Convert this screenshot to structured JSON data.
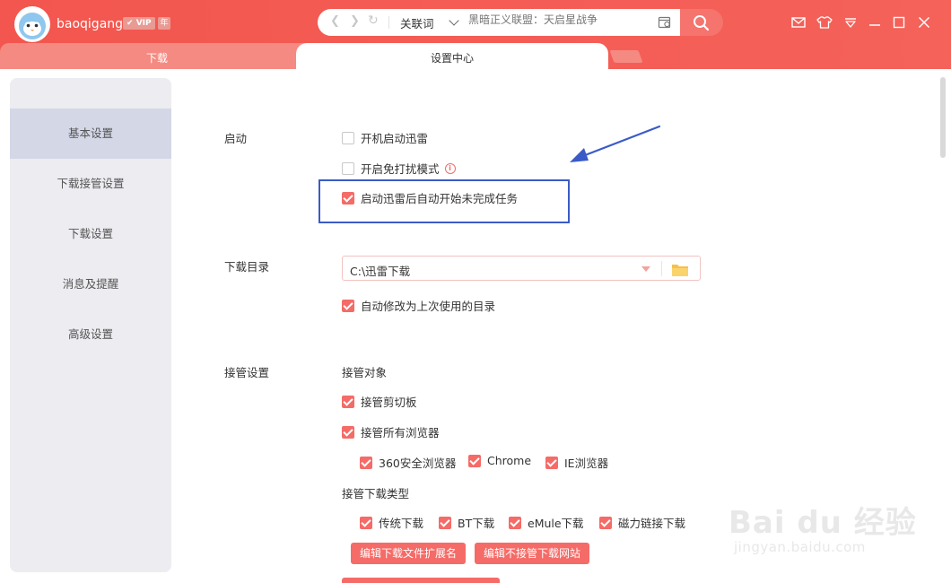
{
  "user": {
    "name": "baoqigang",
    "vip_badge": "VIP",
    "year_badge": "年"
  },
  "address_bar": {
    "search_type": "关联词",
    "placeholder": "黑暗正义联盟：天启星战争"
  },
  "tabs": [
    {
      "label": "下载",
      "active": false
    },
    {
      "label": "设置中心",
      "active": true
    }
  ],
  "sidebar": {
    "items": [
      {
        "label": "基本设置",
        "active": true
      },
      {
        "label": "下载接管设置",
        "active": false
      },
      {
        "label": "下载设置",
        "active": false
      },
      {
        "label": "消息及提醒",
        "active": false
      },
      {
        "label": "高级设置",
        "active": false
      }
    ]
  },
  "startup": {
    "label": "启动",
    "options": [
      {
        "label": "开机启动迅雷",
        "checked": false
      },
      {
        "label": "开启免打扰模式",
        "checked": false,
        "has_info": true
      },
      {
        "label": "启动迅雷后自动开始未完成任务",
        "checked": true,
        "highlighted": true
      }
    ]
  },
  "download_dir": {
    "label": "下载目录",
    "value": "C:\\迅雷下载",
    "auto_modify": {
      "label": "自动修改为上次使用的目录",
      "checked": true
    }
  },
  "takeover": {
    "label": "接管设置",
    "target_heading": "接管对象",
    "clipboard": {
      "label": "接管剪切板",
      "checked": true
    },
    "all_browsers": {
      "label": "接管所有浏览器",
      "checked": true
    },
    "browsers": [
      {
        "label": "360安全浏览器",
        "checked": true
      },
      {
        "label": "Chrome",
        "checked": true
      },
      {
        "label": "IE浏览器",
        "checked": true
      }
    ],
    "types_heading": "接管下载类型",
    "types": [
      {
        "label": "传统下载",
        "checked": true
      },
      {
        "label": "BT下载",
        "checked": true
      },
      {
        "label": "eMule下载",
        "checked": true
      },
      {
        "label": "磁力链接下载",
        "checked": true
      }
    ],
    "buttons": {
      "edit_extensions": "编辑下载文件扩展名",
      "edit_excluded_sites": "编辑不接管下载网站"
    }
  },
  "watermark": {
    "main": "Bai du 经验",
    "sub": "jingyan.baidu.com"
  },
  "colors": {
    "accent": "#f56b67",
    "titlebar": "#f3564e",
    "highlight_box": "#3a5bc7"
  }
}
